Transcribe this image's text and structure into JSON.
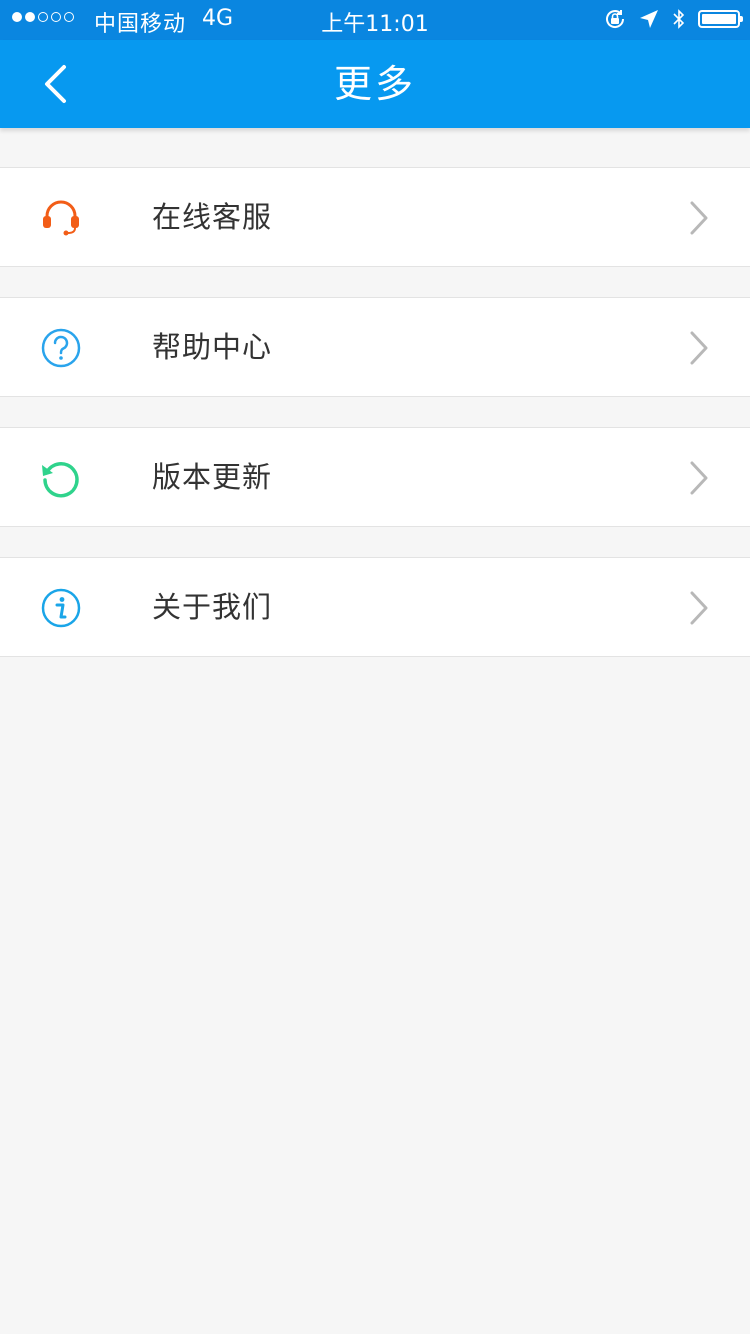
{
  "status_bar": {
    "carrier": "中国移动",
    "network": "4G",
    "time": "上午11:01",
    "icons": [
      "orientation-lock-icon",
      "location-arrow-icon",
      "bluetooth-icon",
      "battery-icon"
    ]
  },
  "nav": {
    "title": "更多",
    "back_icon": "chevron-left-icon"
  },
  "menu": {
    "items": [
      {
        "label": "在线客服",
        "icon": "headset-icon",
        "icon_color": "#f25d17"
      },
      {
        "label": "帮助中心",
        "icon": "question-circle-icon",
        "icon_color": "#2aa4ec"
      },
      {
        "label": "版本更新",
        "icon": "refresh-icon",
        "icon_color": "#2fd38c"
      },
      {
        "label": "关于我们",
        "icon": "info-circle-icon",
        "icon_color": "#1aa5e8"
      }
    ]
  },
  "colors": {
    "status_bar": "#0a86e0",
    "nav_bar": "#0799f0",
    "background": "#f6f6f6",
    "chevron": "#b8b8b8"
  }
}
